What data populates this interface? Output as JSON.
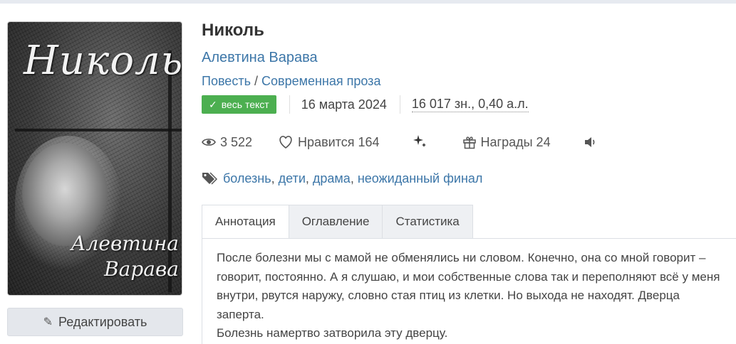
{
  "book": {
    "title": "Николь",
    "author": "Алевтина Варава",
    "genre": "Повесть",
    "genre_separator": "/",
    "subgenre": "Современная проза"
  },
  "cover": {
    "title_text": "Николь",
    "author_text": "Алевтина Варава"
  },
  "meta": {
    "badge_label": "весь текст",
    "date": "16 марта 2024",
    "size": "16 017 зн., 0,40 а.л."
  },
  "stats": {
    "views": "3 522",
    "likes_label": "Нравится 164",
    "awards_label": "Награды 24"
  },
  "tags": [
    "болезнь",
    "дети",
    "драма",
    "неожиданный финал"
  ],
  "tags_separator": ",",
  "tabs": [
    {
      "label": "Аннотация",
      "active": true
    },
    {
      "label": "Оглавление",
      "active": false
    },
    {
      "label": "Статистика",
      "active": false
    }
  ],
  "annotation": {
    "paragraph1": "После болезни мы с мамой не обменялись ни словом. Конечно, она со мной говорит – говорит, постоянно. А я слушаю, и мои собственные слова так и переполняют всё у меня внутри, рвутся наружу, словно стая птиц из клетки. Но выхода не находят. Дверца заперта.",
    "paragraph2": "Болезнь намертво затворила эту дверцу."
  },
  "edit_button_label": "Редактировать",
  "colors": {
    "link": "#3c76a8",
    "badge": "#4caf50",
    "tab_inactive": "#eef0f3",
    "button_bg": "#e4e7ec"
  },
  "icons": [
    "eye-icon",
    "heart-icon",
    "sparkles-icon",
    "gift-icon",
    "speaker-icon",
    "tag-icon",
    "check-icon",
    "pencil-icon"
  ]
}
